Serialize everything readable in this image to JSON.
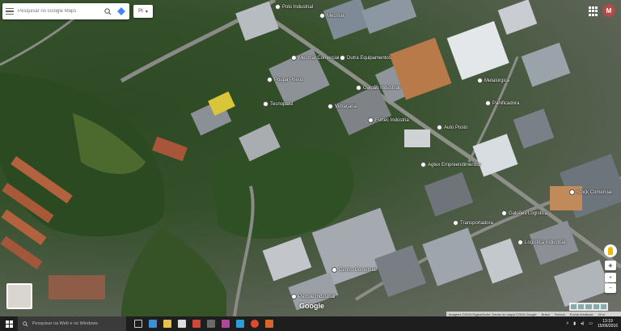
{
  "search": {
    "placeholder": "Pesquisar no Google Maps"
  },
  "language": {
    "value": "Pt"
  },
  "account": {
    "initial": "M"
  },
  "map": {
    "pois": [
      {
        "label": "Polo Industrial"
      },
      {
        "label": "Mecmar"
      },
      {
        "label": "Mecmar Comercial"
      },
      {
        "label": "Dutra Equipamentos"
      },
      {
        "label": "Poupa Pneus"
      },
      {
        "label": "Galpão Industrial"
      },
      {
        "label": "Tecnoplast"
      },
      {
        "label": "Vidraçaria"
      },
      {
        "label": "Fortec Indústria"
      },
      {
        "label": "Auto Posto"
      },
      {
        "label": "Agtex Empreendimentos"
      },
      {
        "label": "Panificadora"
      },
      {
        "label": "Stock Comercial"
      },
      {
        "label": "Centro Comercial"
      },
      {
        "label": "Transportadora"
      },
      {
        "label": "Galpões Logística"
      },
      {
        "label": "Logística Industrial"
      },
      {
        "label": "Parque Industrial"
      },
      {
        "label": "Metalúrgica"
      }
    ],
    "logo": "Google",
    "footer": [
      "Imagens ©2016 DigitalGlobe, Dados do mapa ©2016 Google",
      "Brasil",
      "Termos",
      "Enviar feedback",
      "20 m"
    ]
  },
  "controls": {
    "zoom_in": "+",
    "zoom_out": "−"
  },
  "taskbar": {
    "search_placeholder": "Pesquisar na Web e no Windows",
    "time": "13:19",
    "date": "15/06/2016"
  }
}
